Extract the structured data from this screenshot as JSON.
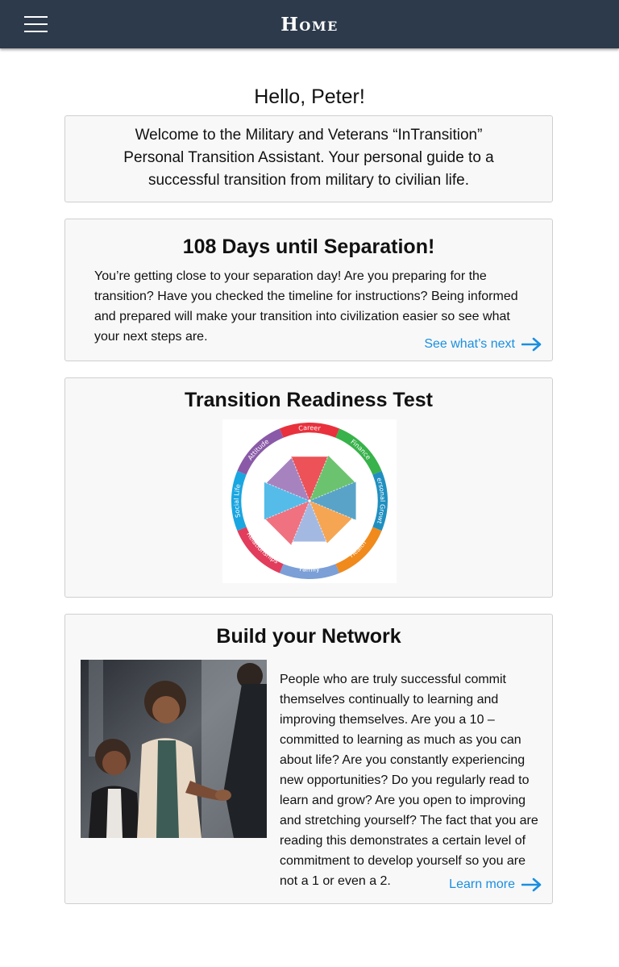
{
  "header": {
    "title": "Home",
    "menu_icon": "hamburger-menu-icon"
  },
  "greeting": "Hello, Peter!",
  "welcome": {
    "text": "Welcome to the Military and Veterans “InTransition” Personal Transition Assistant. Your personal guide to a successful transition from military to civilian life."
  },
  "separation": {
    "heading": "108 Days until Separation!",
    "body": "You’re getting close to your separation day! Are you preparing for the transition? Have you checked the timeline for instructions? Being informed and prepared will make your transition into civilization easier so see what your next steps are.",
    "link": "See what’s next",
    "link_icon": "arrow-right-icon"
  },
  "readiness": {
    "heading": "Transition Readiness Test",
    "segments": [
      {
        "label": "Career",
        "color": "#e8313c",
        "fill": "#ec5257",
        "level": 0.78
      },
      {
        "label": "Finance",
        "color": "#38b24a",
        "fill": "#6cc36f",
        "level": 0.8
      },
      {
        "label": "Personal Growth",
        "color": "#1f8fc0",
        "fill": "#5aa3c8",
        "level": 0.82
      },
      {
        "label": "Health",
        "color": "#f08a1c",
        "fill": "#f6a552",
        "level": 0.75
      },
      {
        "label": "Family",
        "color": "#7b9fd6",
        "fill": "#a4b9e2",
        "level": 0.72
      },
      {
        "label": "Relationships",
        "color": "#e23d5c",
        "fill": "#f0717f",
        "level": 0.78
      },
      {
        "label": "Social Life",
        "color": "#1aa6e0",
        "fill": "#55bce9",
        "level": 0.8
      },
      {
        "label": "Attitude",
        "color": "#8a5aa8",
        "fill": "#a683bf",
        "level": 0.76
      }
    ]
  },
  "network": {
    "heading": "Build your Network",
    "body": "People who are truly successful commit themselves continually to learning and improving themselves. Are you a 10 – committed to learning as much as you can about life? Are you constantly experiencing new opportunities? Do you regularly read to learn and grow? Are you open to improving and stretching yourself? The fact that you are reading this demonstrates a certain level of commitment to develop yourself so you are not a 1 or even a 2.",
    "link": "Learn more",
    "link_icon": "arrow-right-icon"
  },
  "colors": {
    "header_bg": "#2c3a4b",
    "link": "#1a8fe0",
    "card_bg": "#f8f8f8"
  }
}
